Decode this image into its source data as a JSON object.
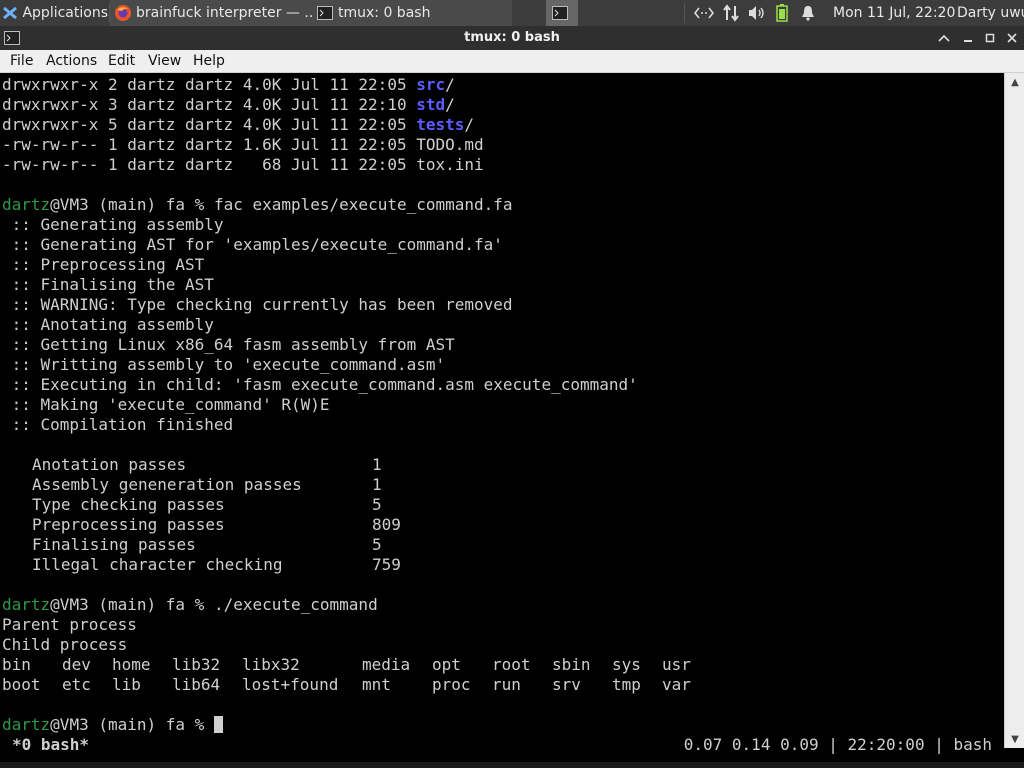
{
  "panel": {
    "apps_label": "Applications",
    "tasks": [
      {
        "label": "brainfuck interpreter — ...",
        "icon": "firefox-icon"
      },
      {
        "label": "tmux: 0 bash",
        "icon": "terminal-icon"
      }
    ],
    "clock": "Mon 11 Jul, 22:20",
    "user": "Darty uwu"
  },
  "window": {
    "title": "tmux: 0 bash"
  },
  "menu": {
    "items": [
      "File",
      "Actions",
      "Edit",
      "View",
      "Help"
    ]
  },
  "terminal": {
    "ls": [
      {
        "perm": "drwxrwxr-x 2 dartz dartz 4.0K Jul 11 22:05 ",
        "name": "src",
        "suffix": "/"
      },
      {
        "perm": "drwxrwxr-x 3 dartz dartz 4.0K Jul 11 22:10 ",
        "name": "std",
        "suffix": "/"
      },
      {
        "perm": "drwxrwxr-x 5 dartz dartz 4.0K Jul 11 22:05 ",
        "name": "tests",
        "suffix": "/"
      },
      {
        "perm": "-rw-rw-r-- 1 dartz dartz 1.6K Jul 11 22:05 ",
        "name": "TODO.md",
        "suffix": ""
      },
      {
        "perm": "-rw-rw-r-- 1 dartz dartz   68 Jul 11 22:05 ",
        "name": "tox.ini",
        "suffix": ""
      }
    ],
    "prompt_user": "dartz",
    "prompt_rest": "@VM3 (main) fa % ",
    "cmd1": "fac examples/execute_command.fa",
    "compile_lines": [
      " :: Generating assembly",
      " :: Generating AST for 'examples/execute_command.fa'",
      " :: Preprocessing AST",
      " :: Finalising the AST",
      " :: WARNING: Type checking currently has been removed",
      " :: Anotating assembly",
      " :: Getting Linux x86_64 fasm assembly from AST",
      " :: Writting assembly to 'execute_command.asm'",
      " :: Executing in child: 'fasm execute_command.asm execute_command'",
      " :: Making 'execute_command' R(W)E",
      " :: Compilation finished"
    ],
    "stats": [
      {
        "label": "Anotation passes",
        "value": "1"
      },
      {
        "label": "Assembly geneneration passes",
        "value": "1"
      },
      {
        "label": "Type checking passes",
        "value": "5"
      },
      {
        "label": "Preprocessing passes",
        "value": "809"
      },
      {
        "label": "Finalising passes",
        "value": "5"
      },
      {
        "label": "Illegal character checking",
        "value": "759"
      }
    ],
    "cmd2": "./execute_command",
    "output_lines": [
      "Parent process",
      "Child process"
    ],
    "dir_row1": [
      "bin",
      "dev",
      "home",
      "lib32",
      "libx32",
      "media",
      "opt",
      "root",
      "sbin",
      "sys",
      "usr"
    ],
    "dir_row2": [
      "boot",
      "etc",
      "lib",
      "lib64",
      "lost+found",
      "mnt",
      "proc",
      "run",
      "srv",
      "tmp",
      "var"
    ]
  },
  "status": {
    "left": "*0 bash*",
    "right": "0.07 0.14 0.09 | 22:20:00 | bash"
  },
  "colors": {
    "prompt_green": "#2e9a46",
    "dir_blue": "#5c5cff"
  }
}
